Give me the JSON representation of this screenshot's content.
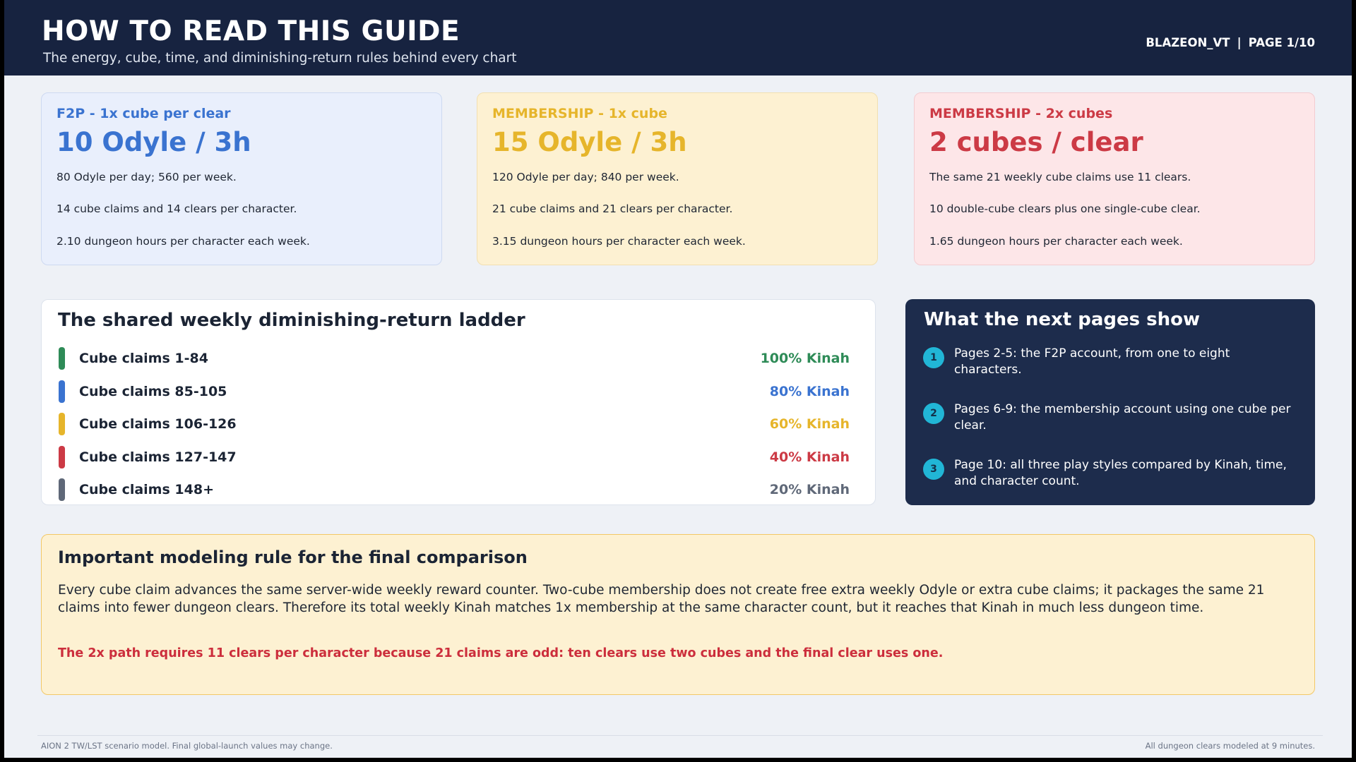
{
  "header": {
    "title": "HOW TO READ THIS GUIDE",
    "subtitle": "The energy, cube, time, and diminishing-return rules behind every chart",
    "author": "BLAZEON_VT",
    "separator": "|",
    "page": "PAGE 1/10"
  },
  "cards": [
    {
      "kicker": "F2P - 1x cube per clear",
      "big": "10 Odyle / 3h",
      "lines": [
        "80 Odyle per day; 560 per week.",
        "14 cube claims and 14 clears per character.",
        "2.10 dungeon hours per character each week."
      ],
      "color": "#3a73d0"
    },
    {
      "kicker": "MEMBERSHIP - 1x cube",
      "big": "15 Odyle / 3h",
      "lines": [
        "120 Odyle per day; 840 per week.",
        "21 cube claims and 21 clears per character.",
        "3.15 dungeon hours per character each week."
      ],
      "color": "#e6b52b"
    },
    {
      "kicker": "MEMBERSHIP - 2x cubes",
      "big": "2 cubes / clear",
      "lines": [
        "The same 21 weekly cube claims use 11 clears.",
        "10 double-cube clears plus one single-cube clear.",
        "1.65 dungeon hours per character each week."
      ],
      "color": "#cc3a45"
    }
  ],
  "ladder": {
    "title": "The shared weekly diminishing-return ladder",
    "rows": [
      {
        "label": "Cube claims 1-84",
        "pct": "100% Kinah",
        "color": "#2e8b57"
      },
      {
        "label": "Cube claims 85-105",
        "pct": "80% Kinah",
        "color": "#3a73d0"
      },
      {
        "label": "Cube claims 106-126",
        "pct": "60% Kinah",
        "color": "#e6b52b"
      },
      {
        "label": "Cube claims 127-147",
        "pct": "40% Kinah",
        "color": "#cc3a45"
      },
      {
        "label": "Cube claims 148+",
        "pct": "20% Kinah",
        "color": "#5f6878"
      }
    ]
  },
  "next": {
    "title": "What the next pages show",
    "steps": [
      {
        "num": "1",
        "text": "Pages 2-5: the F2P account, from one to eight characters."
      },
      {
        "num": "2",
        "text": "Pages 6-9: the membership account using one cube per clear."
      },
      {
        "num": "3",
        "text": "Page 10: all three play styles compared by Kinah, time, and character count."
      }
    ]
  },
  "rule": {
    "title": "Important modeling rule for the final comparison",
    "body": "Every cube claim advances the same server-wide weekly reward counter. Two-cube membership does not create free extra weekly Odyle or extra cube claims; it packages the same 21 claims into fewer dungeon clears. Therefore its total weekly Kinah matches 1x membership at the same character count, but it reaches that Kinah in much less dungeon time.",
    "warning": "The 2x path requires 11 clears per character because 21 claims are odd: ten clears use two cubes and the final clear uses one."
  },
  "footer": {
    "left": "AION 2 TW/LST scenario model. Final global-launch values may change.",
    "right": "All dungeon clears modeled at 9 minutes."
  }
}
